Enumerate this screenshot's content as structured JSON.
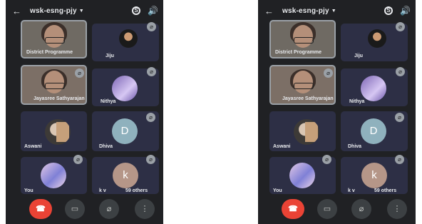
{
  "meeting_title": "wsk-esng-pjy",
  "icons": {
    "back": "arrow-left-icon",
    "dropdown": "chevron-down-icon",
    "camera_switch": "camera-switch-icon",
    "volume": "volume-icon",
    "mic_off": "mic-off-icon",
    "end_call": "phone-hangup-icon",
    "camera_off": "video-off-icon",
    "mic_toggle": "mic-off-icon",
    "more": "more-vert-icon"
  },
  "participants": [
    {
      "name": "District Programme",
      "type": "video"
    },
    {
      "name": "Jiju",
      "type": "avatar"
    },
    {
      "name": "Jayasree Sathyarajan",
      "type": "video"
    },
    {
      "name": "Nithya",
      "type": "avatar"
    },
    {
      "name": "Aswani",
      "type": "avatar"
    },
    {
      "name": "Dhiva",
      "initial": "D",
      "type": "avatar"
    },
    {
      "name": "You",
      "type": "avatar"
    },
    {
      "name": "k v",
      "initial": "k",
      "type": "avatar"
    }
  ],
  "others_count_label": "59 others",
  "colors": {
    "background": "#202124",
    "tile": "#2d2f45",
    "end_call": "#ea4335",
    "control": "#3c4043"
  }
}
